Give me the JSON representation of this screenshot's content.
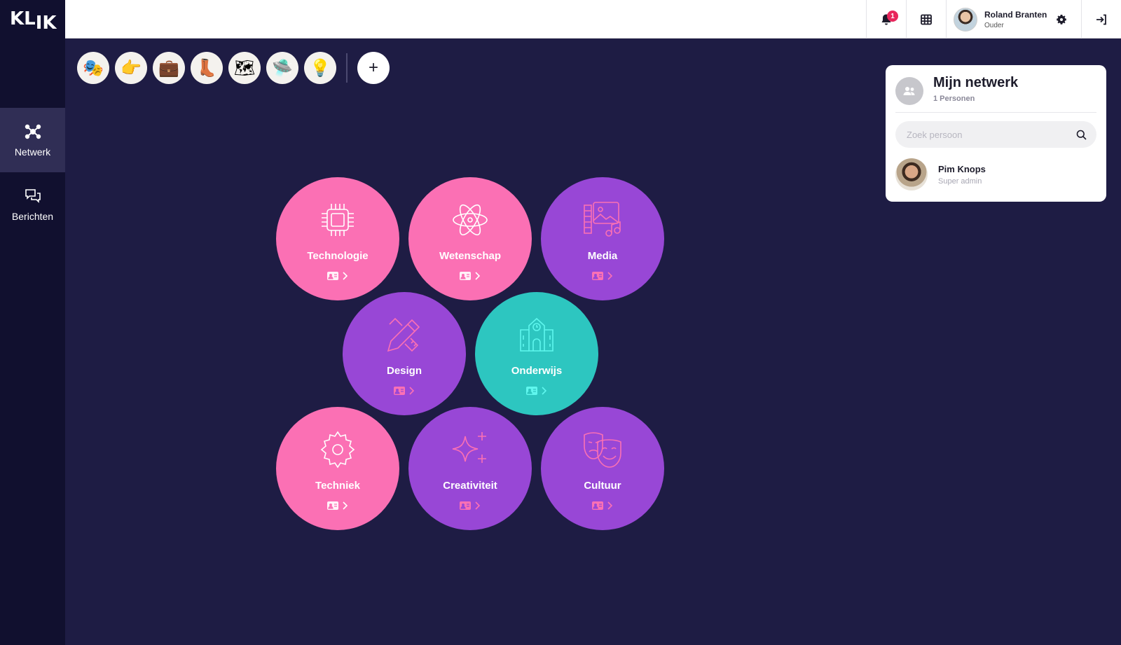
{
  "app": {
    "logo_top": "KL",
    "logo_sub": "IK"
  },
  "sidebar": {
    "items": [
      {
        "label": "Netwerk",
        "icon": "network-icon",
        "active": true
      },
      {
        "label": "Berichten",
        "icon": "chat-icon",
        "active": false
      }
    ]
  },
  "topbar": {
    "notifications_count": "1",
    "user": {
      "name": "Roland Branten",
      "role": "Ouder"
    }
  },
  "strip": {
    "items": [
      {
        "icon": "face-icon",
        "glyph": "🎭"
      },
      {
        "icon": "pointing-hand-icon",
        "glyph": "👉"
      },
      {
        "icon": "suitcase-icon",
        "glyph": "💼"
      },
      {
        "icon": "boot-icon",
        "glyph": "👢"
      },
      {
        "icon": "map-icon",
        "glyph": "🗺"
      },
      {
        "icon": "drone-icon",
        "glyph": "🛸"
      },
      {
        "icon": "heart-bulb-icon",
        "glyph": "💡"
      }
    ],
    "add_label": "+"
  },
  "categories": [
    {
      "label": "Technologie",
      "color": "#fb70b4",
      "icon": "chip-icon"
    },
    {
      "label": "Wetenschap",
      "color": "#fb70b4",
      "icon": "atom-icon"
    },
    {
      "label": "Media",
      "color": "#9847d6",
      "icon": "media-icon"
    },
    {
      "label": "Design",
      "color": "#9847d6",
      "icon": "pencil-ruler-icon"
    },
    {
      "label": "Onderwijs",
      "color": "#2dc6c0",
      "icon": "school-icon"
    },
    {
      "label": "Techniek",
      "color": "#fb70b4",
      "icon": "gear-icon"
    },
    {
      "label": "Creativiteit",
      "color": "#9847d6",
      "icon": "sparkles-icon"
    },
    {
      "label": "Cultuur",
      "color": "#9847d6",
      "icon": "theater-masks-icon"
    }
  ],
  "network": {
    "title": "Mijn netwerk",
    "subtitle": "1 Personen",
    "search_placeholder": "Zoek persoon",
    "people": [
      {
        "name": "Pim Knops",
        "role": "Super admin"
      }
    ]
  }
}
